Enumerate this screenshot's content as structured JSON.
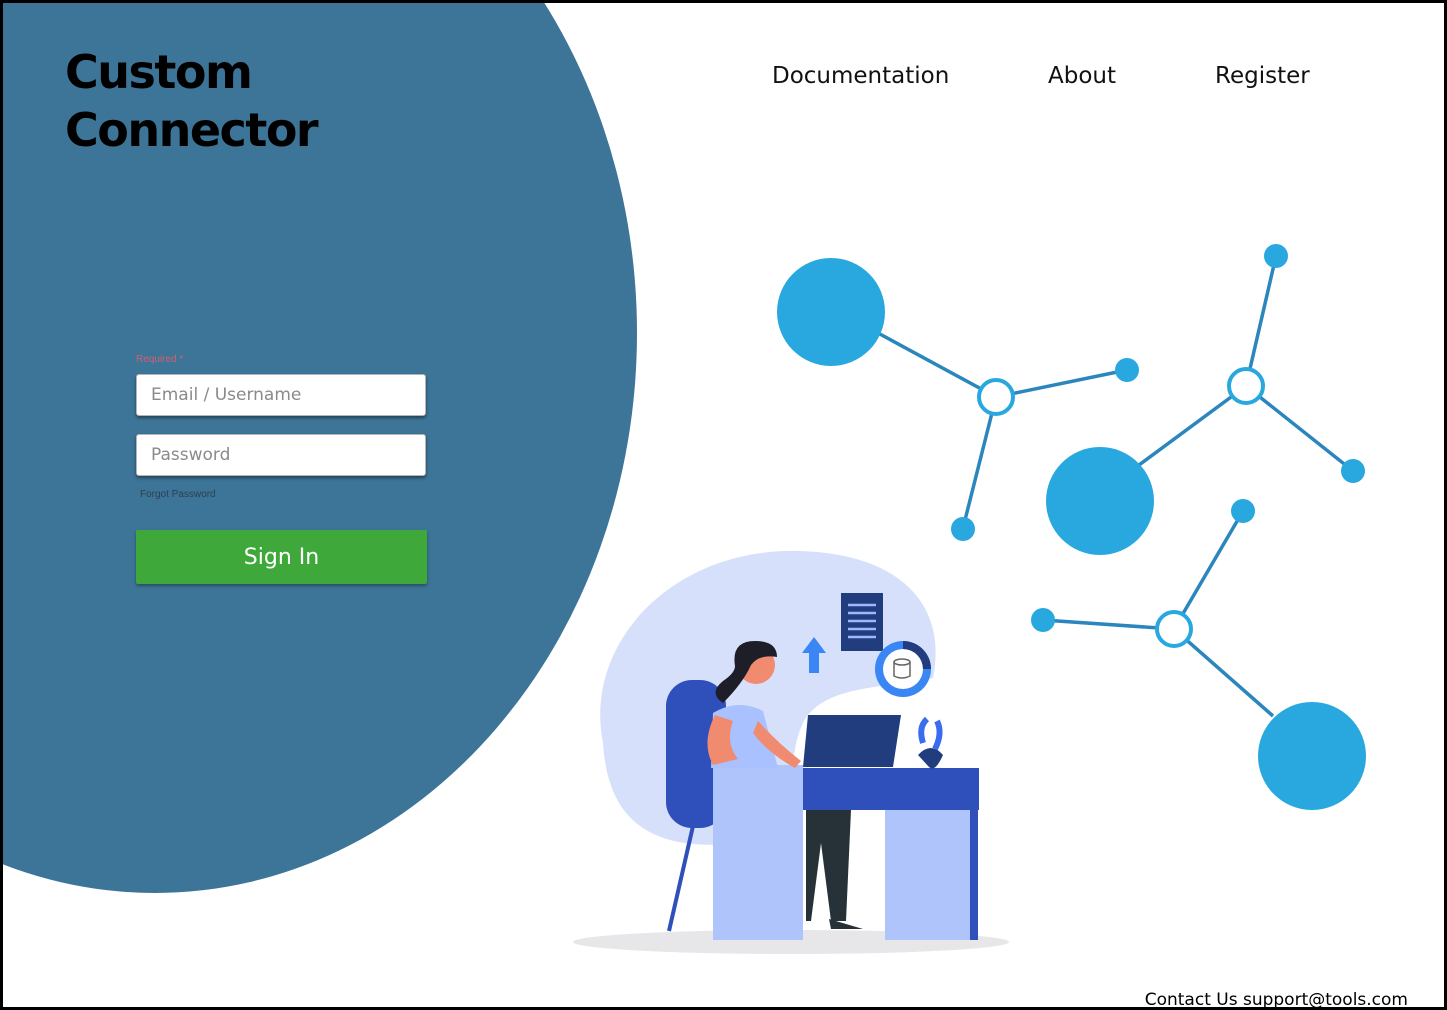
{
  "brand": {
    "line1": "Custom",
    "line2": "Connector"
  },
  "nav": {
    "documentation": "Documentation",
    "about": "About",
    "register": "Register"
  },
  "login": {
    "required_label": "Required *",
    "email_placeholder": "Email / Username",
    "password_placeholder": "Password",
    "forgot_password": "Forgot Password",
    "sign_in": "Sign In"
  },
  "footer": {
    "contact": "Contact Us support@tools.com"
  },
  "colors": {
    "hero_blob": "#3d7598",
    "sign_in_button": "#3fa83a",
    "network_node": "#29a8e0",
    "network_line": "#2a86bd"
  }
}
